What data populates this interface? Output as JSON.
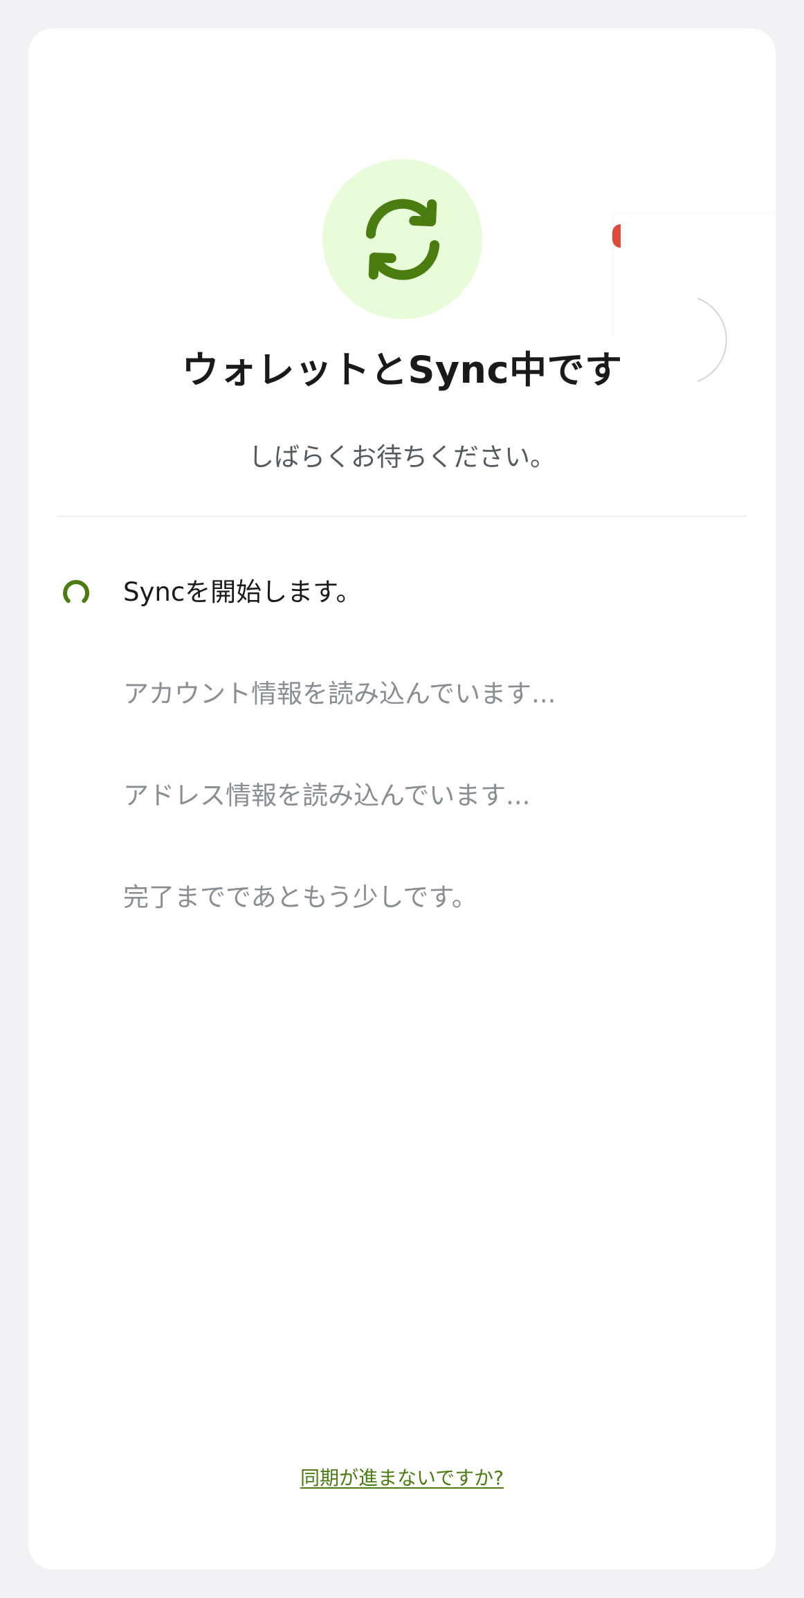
{
  "header": {
    "title": "ウォレットとSync中です",
    "subtitle": "しばらくお待ちください。"
  },
  "hero_icon": "sync-icon",
  "steps": [
    {
      "label": "Syncを開始します。",
      "state": "active"
    },
    {
      "label": "アカウント情報を読み込んでいます...",
      "state": "pending"
    },
    {
      "label": "アドレス情報を読み込んでいます...",
      "state": "pending"
    },
    {
      "label": "完了までであともう少しです。",
      "state": "pending"
    }
  ],
  "footer": {
    "help_link": "同期が進まないですか?"
  },
  "colors": {
    "accent": "#4b7c10",
    "hero_background": "#e8fcd9",
    "page_background": "#f2f2f4",
    "card_background": "#ffffff"
  }
}
